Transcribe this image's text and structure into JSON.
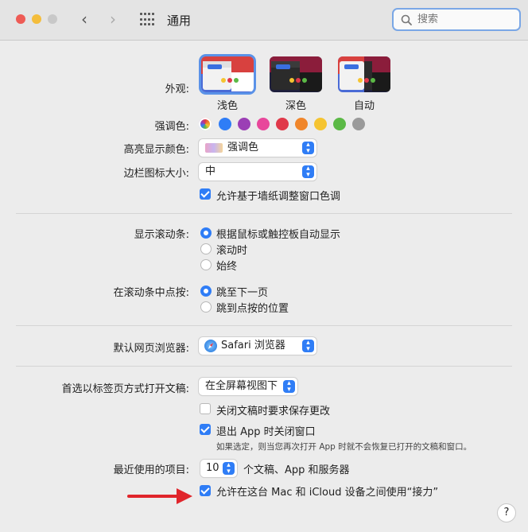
{
  "window": {
    "title": "通用",
    "search_placeholder": "搜索",
    "nav": {
      "back": "‹",
      "forward": "›"
    }
  },
  "appearance": {
    "label": "外观:",
    "options": [
      {
        "name": "浅色",
        "selected": true
      },
      {
        "name": "深色",
        "selected": false
      },
      {
        "name": "自动",
        "selected": false
      }
    ]
  },
  "accent": {
    "label": "强调色:",
    "colors": [
      "multicolor",
      "#2f7df6",
      "#9b3fb5",
      "#e8479b",
      "#e0394a",
      "#f0862b",
      "#f5c431",
      "#5bb946",
      "#9a9a9a"
    ]
  },
  "highlight": {
    "label": "高亮显示颜色:",
    "value": "强调色"
  },
  "sidebar_icon": {
    "label": "边栏图标大小:",
    "value": "中"
  },
  "wallpaper_tint": {
    "label": "允许基于墙纸调整窗口色调",
    "checked": true
  },
  "scrollbars": {
    "label": "显示滚动条:",
    "options": [
      {
        "text": "根据鼠标或触控板自动显示",
        "selected": true
      },
      {
        "text": "滚动时",
        "selected": false
      },
      {
        "text": "始终",
        "selected": false
      }
    ]
  },
  "scroll_click": {
    "label": "在滚动条中点按:",
    "options": [
      {
        "text": "跳至下一页",
        "selected": true
      },
      {
        "text": "跳到点按的位置",
        "selected": false
      }
    ]
  },
  "browser": {
    "label": "默认网页浏览器:",
    "value": "Safari 浏览器"
  },
  "tabs": {
    "label": "首选以标签页方式打开文稿:",
    "value": "在全屏幕视图下"
  },
  "ask_save": {
    "label": "关闭文稿时要求保存更改",
    "checked": false
  },
  "close_windows": {
    "label": "退出 App 时关闭窗口",
    "checked": true,
    "note": "如果选定，则当您再次打开 App 时就不会恢复已打开的文稿和窗口。"
  },
  "recent": {
    "label": "最近使用的项目:",
    "value": "10",
    "suffix": "个文稿、App 和服务器"
  },
  "handoff": {
    "label": "允许在这台 Mac 和 iCloud 设备之间使用“接力”",
    "checked": true
  },
  "help": "?",
  "colors": {
    "accent": "#2f7df6",
    "arrow": "#e0252b"
  }
}
